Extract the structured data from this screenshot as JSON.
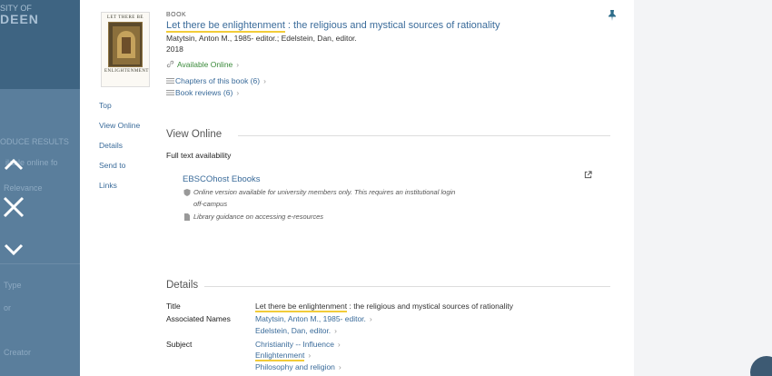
{
  "background": {
    "logo_line1": "SITY OF",
    "logo_line2": "DEEN",
    "side_text_1": "ODUCE RESULTS",
    "side_text_2": "ilable online fo",
    "side_text_3": "Relevance",
    "side_text_4": "Type",
    "side_text_5": "or",
    "side_text_6": "Creator"
  },
  "nav_icons": [
    "chevron-up-icon",
    "close-icon",
    "chevron-down-icon"
  ],
  "record": {
    "type": "BOOK",
    "title_highlight": "Let there be enlightenment",
    "title_rest": " : the religious and mystical sources of rationality",
    "authors": "Matytsin, Anton M., 1985- editor.; Edelstein, Dan, editor.",
    "year": "2018",
    "available": "Available Online",
    "chapters": "Chapters of this book (6)",
    "reviews": "Book reviews (6)",
    "cover_title": "LET THERE BE",
    "cover_subtitle": "ENLIGHTENMENT"
  },
  "side_nav": [
    "Top",
    "View Online",
    "Details",
    "Send to",
    "Links"
  ],
  "view_online": {
    "heading": "View Online",
    "full_text": "Full text availability",
    "provider": "EBSCOhost Ebooks",
    "note_1": "Online version available for university members only. This requires an institutional login",
    "note_1b": "off-campus",
    "note_2": "Library guidance on accessing e-resources"
  },
  "details": {
    "heading": "Details",
    "title_label": "Title",
    "title_highlight": "Let there be enlightenment",
    "title_rest": " : the religious and mystical sources of rationality",
    "names_label": "Associated Names",
    "name_1": "Matytsin, Anton M., 1985- editor.",
    "name_2": "Edelstein, Dan, editor.",
    "subject_label": "Subject",
    "subject_1": "Christianity -- Influence",
    "subject_2": "Enlightenment",
    "subject_3": "Philosophy and religion"
  },
  "colors": {
    "link": "#3a6b9a",
    "available": "#3a8a3a",
    "highlight": "#f2cc39",
    "overlay": "#4b6e8b"
  }
}
